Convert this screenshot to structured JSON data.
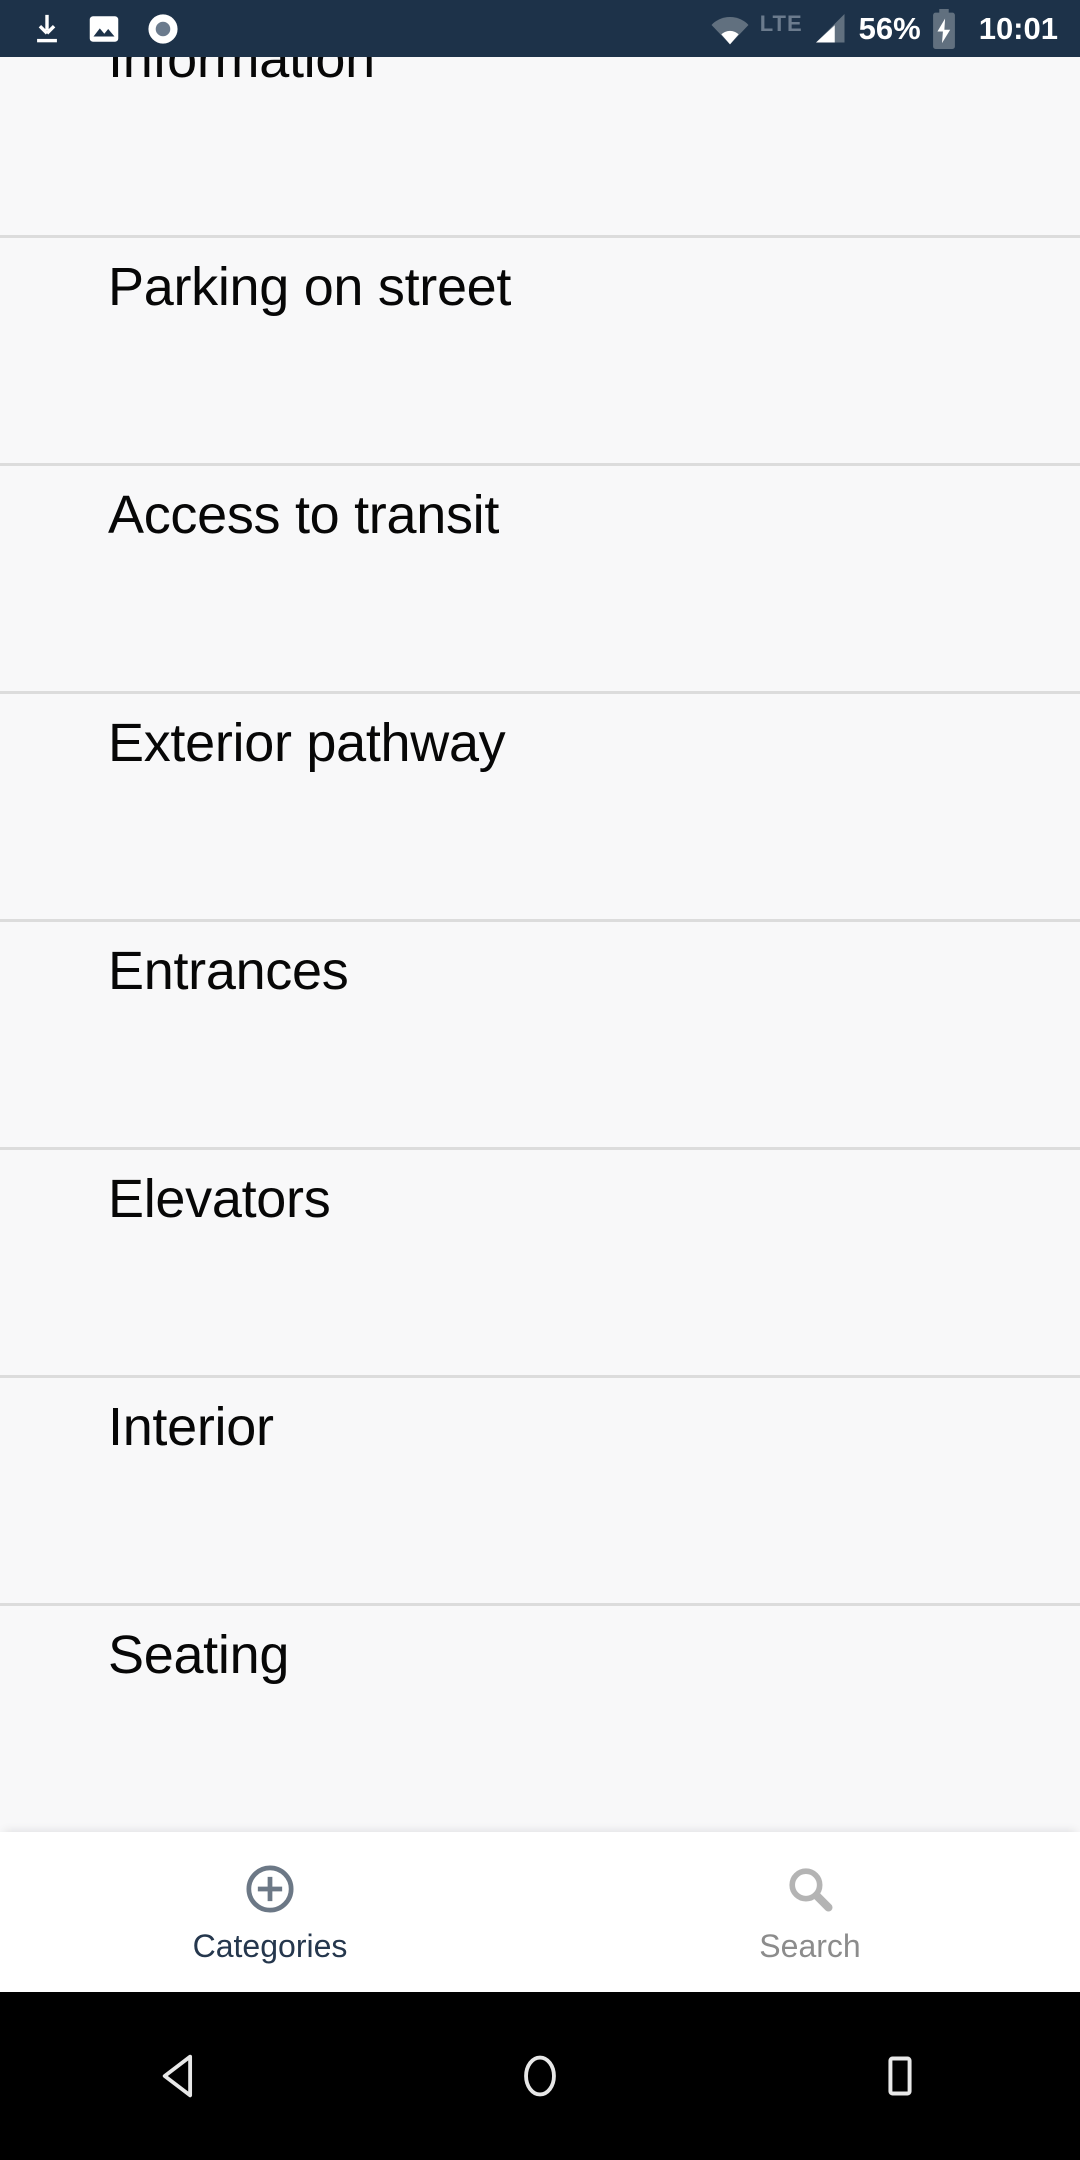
{
  "status_bar": {
    "background_color": "#1d3249",
    "left_icons": [
      {
        "name": "download-icon",
        "label": "download"
      },
      {
        "name": "image-icon",
        "label": "screenshot"
      },
      {
        "name": "record-icon",
        "label": "screen-record"
      }
    ],
    "wifi_icon": "wifi-icon",
    "network_type": "LTE",
    "signal_icon": "signal-bars-icon",
    "battery_percent": "56%",
    "battery_icon": "battery-charging-icon",
    "clock": "10:01"
  },
  "list": {
    "items": [
      {
        "label": "Information"
      },
      {
        "label": "Parking on street"
      },
      {
        "label": "Access to transit"
      },
      {
        "label": "Exterior pathway"
      },
      {
        "label": "Entrances"
      },
      {
        "label": "Elevators"
      },
      {
        "label": "Interior"
      },
      {
        "label": "Seating"
      }
    ]
  },
  "tab_bar": {
    "active_color": "#25374d",
    "inactive_color": "#8c8c8c",
    "icon_active_color": "#6c7886",
    "icon_inactive_color": "#b4b4b4",
    "tabs": [
      {
        "label": "Categories",
        "icon": "plus-circle-icon",
        "active": true
      },
      {
        "label": "Search",
        "icon": "search-icon",
        "active": false
      }
    ]
  },
  "nav_bar": {
    "background_color": "#000000",
    "buttons": [
      {
        "name": "back-button",
        "icon": "triangle-back-icon"
      },
      {
        "name": "home-button",
        "icon": "circle-home-icon"
      },
      {
        "name": "recents-button",
        "icon": "square-recents-icon"
      }
    ]
  }
}
